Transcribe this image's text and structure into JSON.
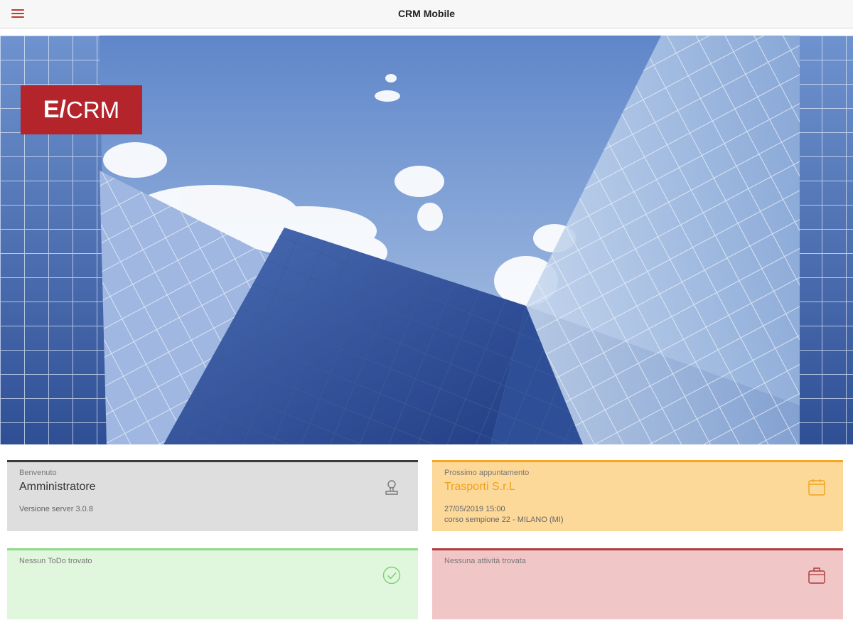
{
  "app": {
    "title": "CRM Mobile"
  },
  "header": {
    "menu_icon": "hamburger-menu-icon"
  },
  "logo": {
    "prefix": "E/",
    "suffix": "CRM",
    "color": "#b3242b"
  },
  "cards": {
    "welcome": {
      "label": "Benvenuto",
      "user": "Amministratore",
      "server_version": "Versione server 3.0.8",
      "icon": "user-icon"
    },
    "appointment": {
      "label": "Prossimo appuntamento",
      "company": "Trasporti S.r.L",
      "datetime": "27/05/2019 15:00",
      "address": "corso sempione 22 - MILANO (MI)",
      "icon": "calendar-icon"
    },
    "todo": {
      "label": "Nessun ToDo trovato",
      "icon": "check-circle-icon"
    },
    "activities": {
      "label": "Nessuna attività trovata",
      "icon": "briefcase-icon"
    }
  },
  "colors": {
    "welcome_border": "#3a3a3a",
    "appointment_border": "#f5a623",
    "todo_border": "#8fd98a",
    "activities_border": "#b33a3a"
  }
}
